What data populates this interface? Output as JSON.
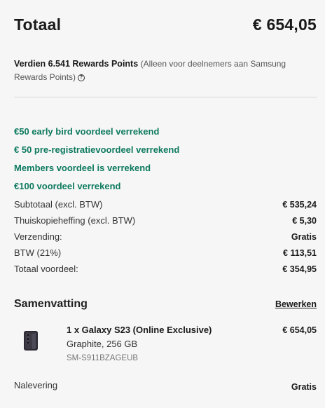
{
  "total": {
    "label": "Totaal",
    "amount": "€ 654,05"
  },
  "rewards": {
    "strong": "Verdien 6.541 Rewards Points",
    "note": "(Alleen voor deelnemers aan Samsung Rewards Points)",
    "info_icon": "?"
  },
  "promos": [
    "€50 early bird voordeel verrekend",
    "€ 50 pre-registratievoordeel verrekend",
    "Members voordeel is verrekend",
    "€100 voordeel verrekend"
  ],
  "lines": [
    {
      "label": "Subtotaal (excl. BTW)",
      "value": "€ 535,24"
    },
    {
      "label": "Thuiskopieheffing (excl. BTW)",
      "value": "€ 5,30"
    },
    {
      "label": "Verzending:",
      "value": "Gratis"
    },
    {
      "label": "BTW (21%)",
      "value": "€ 113,51"
    },
    {
      "label": "Totaal voordeel:",
      "value": "€ 354,95"
    }
  ],
  "summary": {
    "title": "Samenvatting",
    "edit_label": "Bewerken"
  },
  "product": {
    "name": "1 x Galaxy S23 (Online Exclusive)",
    "variant": "Graphite, 256 GB",
    "sku": "SM-S911BZAGEUB",
    "price": "€ 654,05",
    "image_icon": "phone-icon"
  },
  "delivery": {
    "label": "Nalevering",
    "value": "Gratis"
  },
  "colors": {
    "promo_green": "#0e7a5f",
    "background": "#f6f6f6"
  }
}
